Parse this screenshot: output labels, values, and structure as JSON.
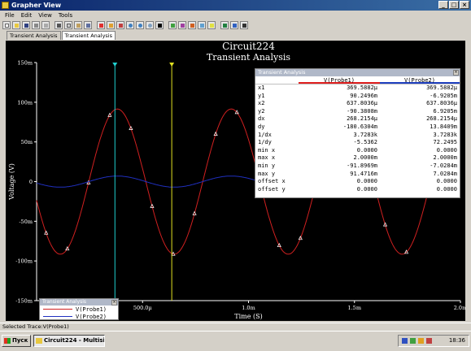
{
  "window": {
    "title": "Grapher View"
  },
  "menu": [
    "File",
    "Edit",
    "View",
    "Tools"
  ],
  "tabs": [
    {
      "label": "Transient Analysis",
      "active": false
    },
    {
      "label": "Transient Analysis",
      "active": true
    }
  ],
  "status": {
    "text": "Selected Trace:V(Probe1)"
  },
  "taskbar": {
    "start_label": "Пуск",
    "task_label": "Circuit224 - Multisim ...",
    "clock": "18:36"
  },
  "cursor_panel": {
    "title": "Transient Analysis",
    "headers": [
      "V(Probe1)",
      "V(Probe2)"
    ],
    "rows": [
      {
        "label": "x1",
        "v1": "369.5882µ",
        "v2": "369.5882µ"
      },
      {
        "label": "y1",
        "v1": "90.2496m",
        "v2": "-6.9205m"
      },
      {
        "label": "x2",
        "v1": "637.8036µ",
        "v2": "637.8036µ"
      },
      {
        "label": "y2",
        "v1": "-90.3808m",
        "v2": "6.9205m"
      },
      {
        "label": "dx",
        "v1": "268.2154µ",
        "v2": "268.2154µ"
      },
      {
        "label": "dy",
        "v1": "-180.6304m",
        "v2": "13.8409m"
      },
      {
        "label": "1/dx",
        "v1": "3.7283k",
        "v2": "3.7283k"
      },
      {
        "label": "1/dy",
        "v1": "-5.5362",
        "v2": "72.2495"
      },
      {
        "label": "min x",
        "v1": "0.0000",
        "v2": "0.0000"
      },
      {
        "label": "max x",
        "v1": "2.0000m",
        "v2": "2.0000m"
      },
      {
        "label": "min y",
        "v1": "-91.8969m",
        "v2": "-7.0284m"
      },
      {
        "label": "max y",
        "v1": "91.4716m",
        "v2": "7.0284m"
      },
      {
        "label": "offset x",
        "v1": "0.0000",
        "v2": "0.0000"
      },
      {
        "label": "offset y",
        "v1": "0.0000",
        "v2": "0.0000"
      }
    ]
  },
  "legend_panel": {
    "title": "Transient Analysis",
    "items": [
      "V(Probe1)",
      "V(Probe2)"
    ]
  },
  "colors": {
    "probe1": "#d02020",
    "probe2": "#2030c0",
    "cursor1": "#20d0d0",
    "cursor2": "#e0e020",
    "plot_bg": "#000000"
  },
  "chart_data": {
    "type": "line",
    "title": "Circuit224",
    "subtitle": "Transient Analysis",
    "xlabel": "Time (S)",
    "ylabel": "Voltage (V)",
    "xlim": [
      0,
      0.002
    ],
    "ylim": [
      -0.15,
      0.15
    ],
    "x_ticks": [
      {
        "value": 0.0005,
        "label": "500.0µ"
      },
      {
        "value": 0.001,
        "label": "1.0m"
      },
      {
        "value": 0.0015,
        "label": "1.5m"
      },
      {
        "value": 0.002,
        "label": "2.0m"
      }
    ],
    "y_ticks": [
      {
        "value": 0.15,
        "label": "150m"
      },
      {
        "value": 0.1,
        "label": "100m"
      },
      {
        "value": 0.05,
        "label": "50m"
      },
      {
        "value": 0,
        "label": "0"
      },
      {
        "value": -0.05,
        "label": "-50m"
      },
      {
        "value": -0.1,
        "label": "-100m"
      },
      {
        "value": -0.15,
        "label": "-150m"
      }
    ],
    "grid": false,
    "series": [
      {
        "name": "V(Probe1)",
        "amplitude": 0.0915,
        "frequency_hz": 1860,
        "phase_deg": -165
      },
      {
        "name": "V(Probe2)",
        "amplitude": 0.007,
        "frequency_hz": 1860,
        "phase_deg": -165
      }
    ],
    "cursors": [
      {
        "label": "1",
        "x": 0.0003695882
      },
      {
        "label": "2",
        "x": 0.0006378036
      }
    ]
  }
}
